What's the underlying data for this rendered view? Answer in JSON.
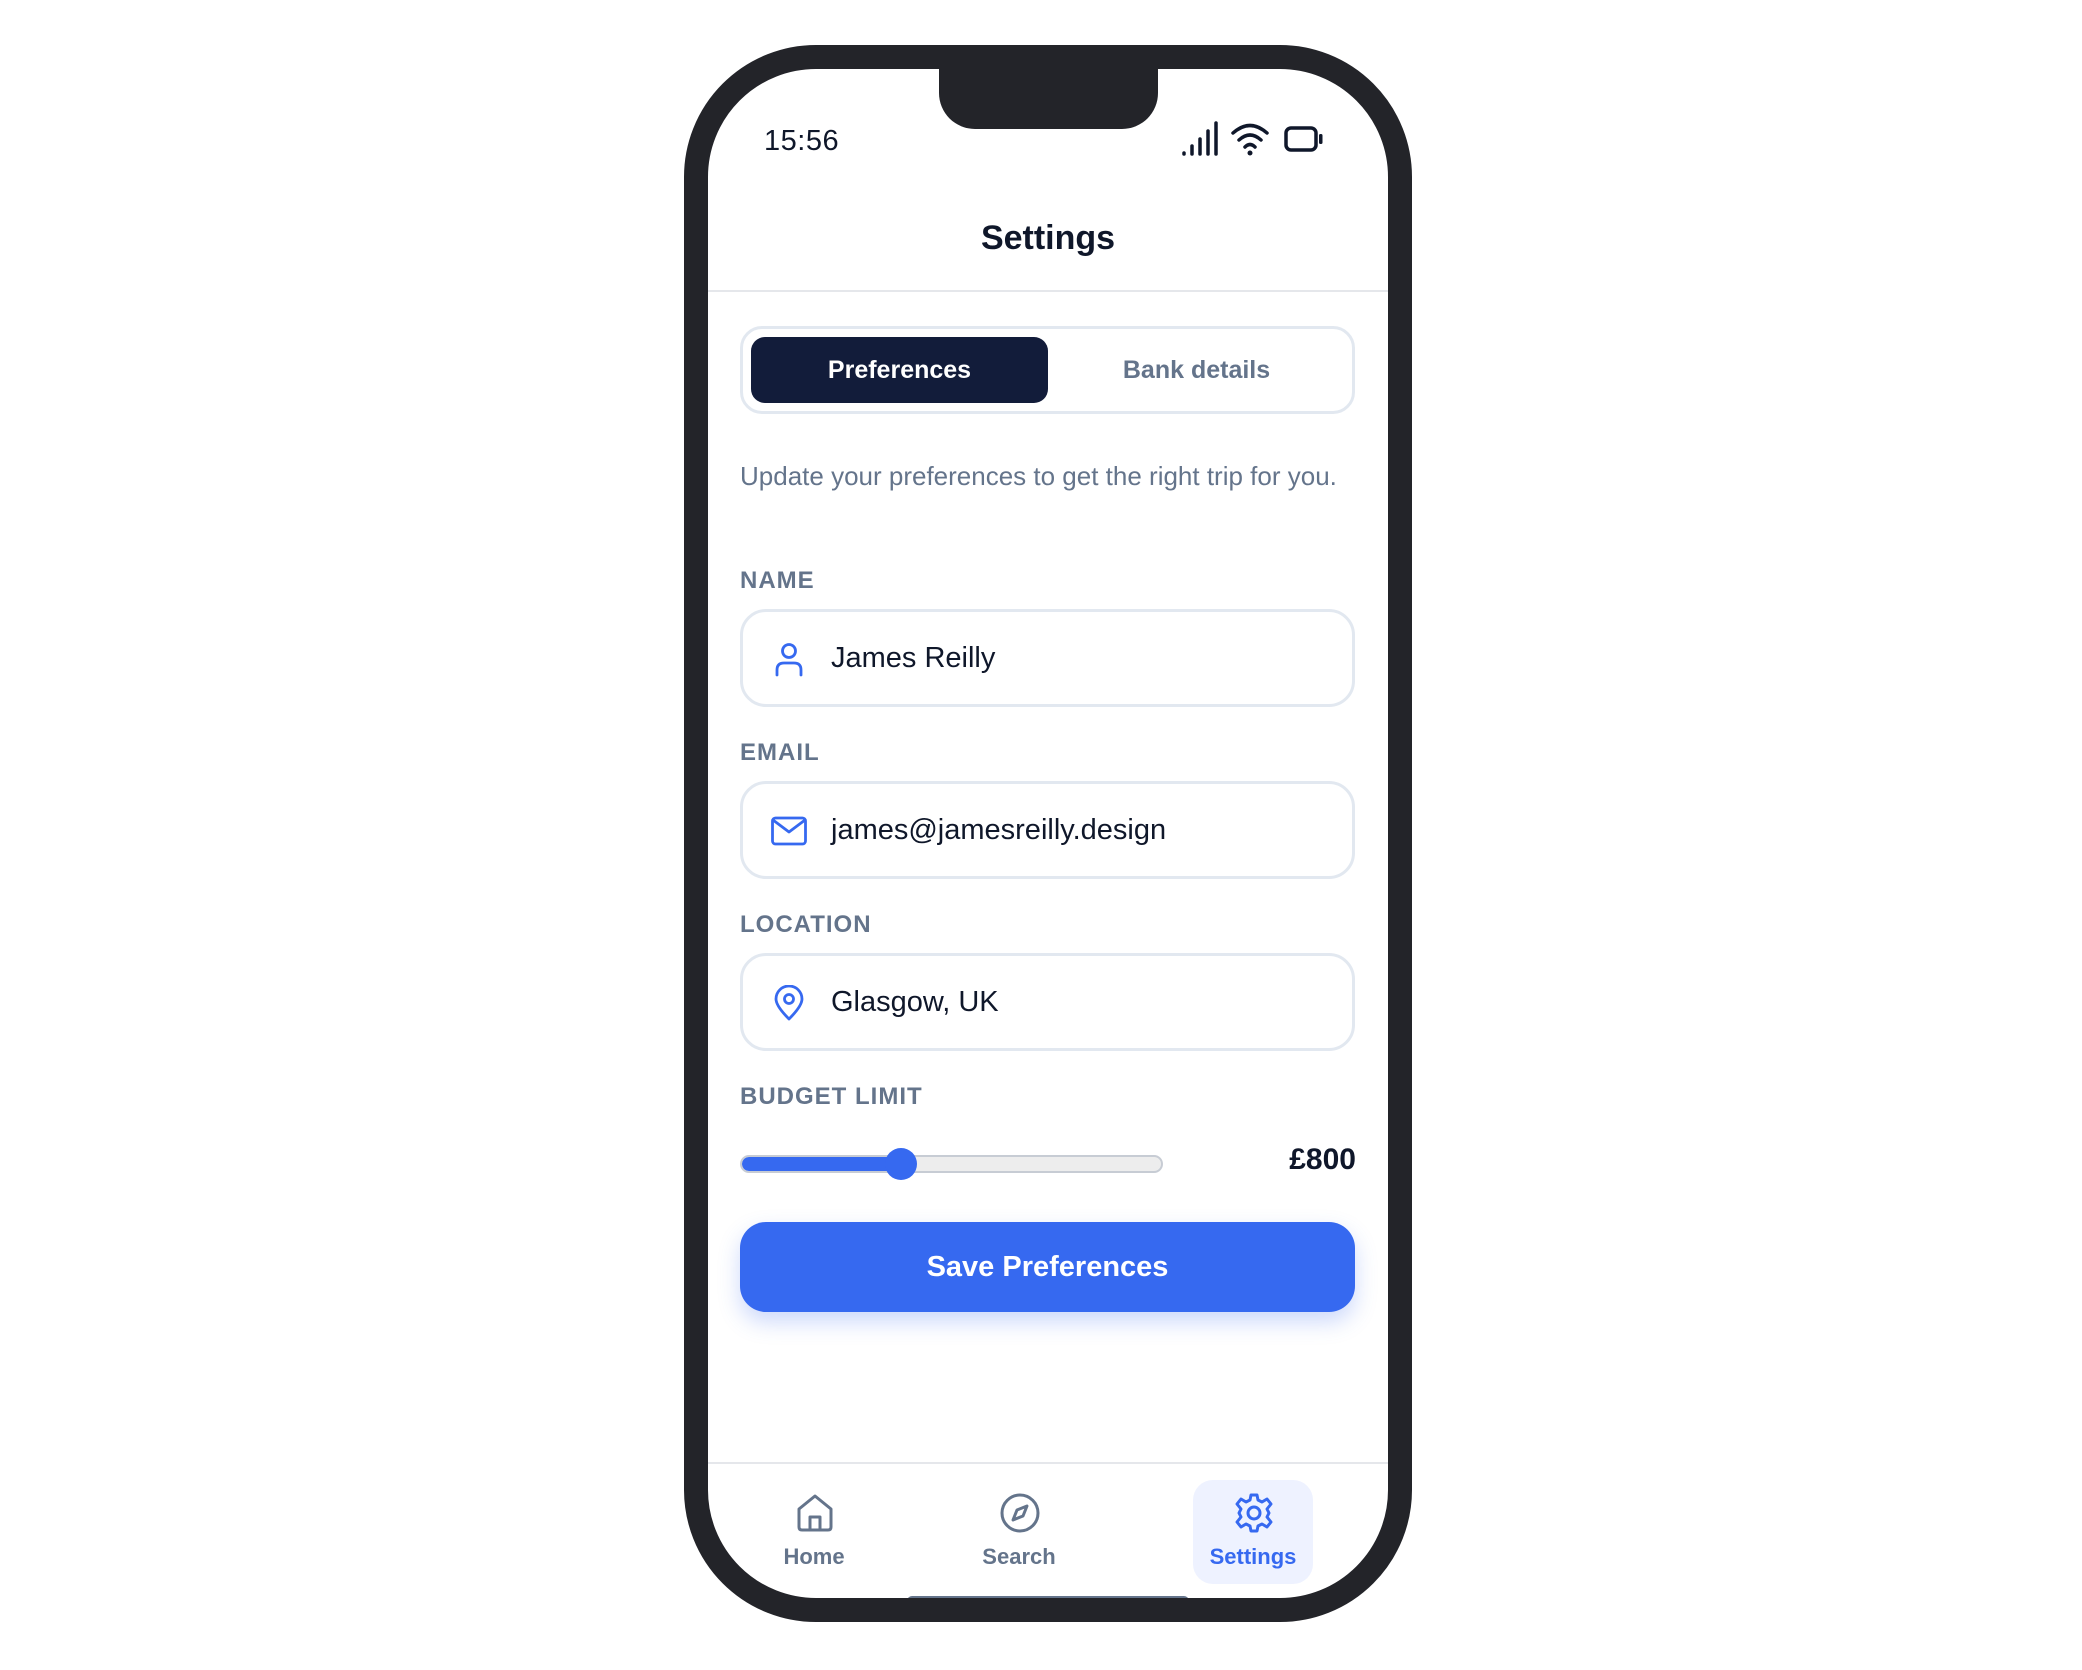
{
  "status_bar": {
    "time": "15:56"
  },
  "header": {
    "title": "Settings"
  },
  "tabs": [
    {
      "label": "Preferences",
      "active": true
    },
    {
      "label": "Bank details",
      "active": false
    }
  ],
  "intro_text": "Update your preferences to get the right trip for you.",
  "form": {
    "name": {
      "label": "NAME",
      "value": "James Reilly",
      "icon": "user-icon"
    },
    "email": {
      "label": "EMAIL",
      "value": "james@jamesreilly.design",
      "icon": "mail-icon"
    },
    "location": {
      "label": "LOCATION",
      "value": "Glasgow, UK",
      "icon": "map-pin-icon"
    },
    "budget": {
      "label": "BUDGET LIMIT",
      "value": "£800",
      "slider_fraction": 0.38
    }
  },
  "save_button": {
    "label": "Save Preferences"
  },
  "bottom_nav": [
    {
      "label": "Home",
      "icon": "home-icon",
      "active": false
    },
    {
      "label": "Search",
      "icon": "compass-icon",
      "active": false
    },
    {
      "label": "Settings",
      "icon": "gear-icon",
      "active": true
    }
  ],
  "colors": {
    "accent": "#3669f0",
    "tab_active_bg": "#121c3a",
    "muted_text": "#64748b",
    "text": "#0f172a"
  }
}
